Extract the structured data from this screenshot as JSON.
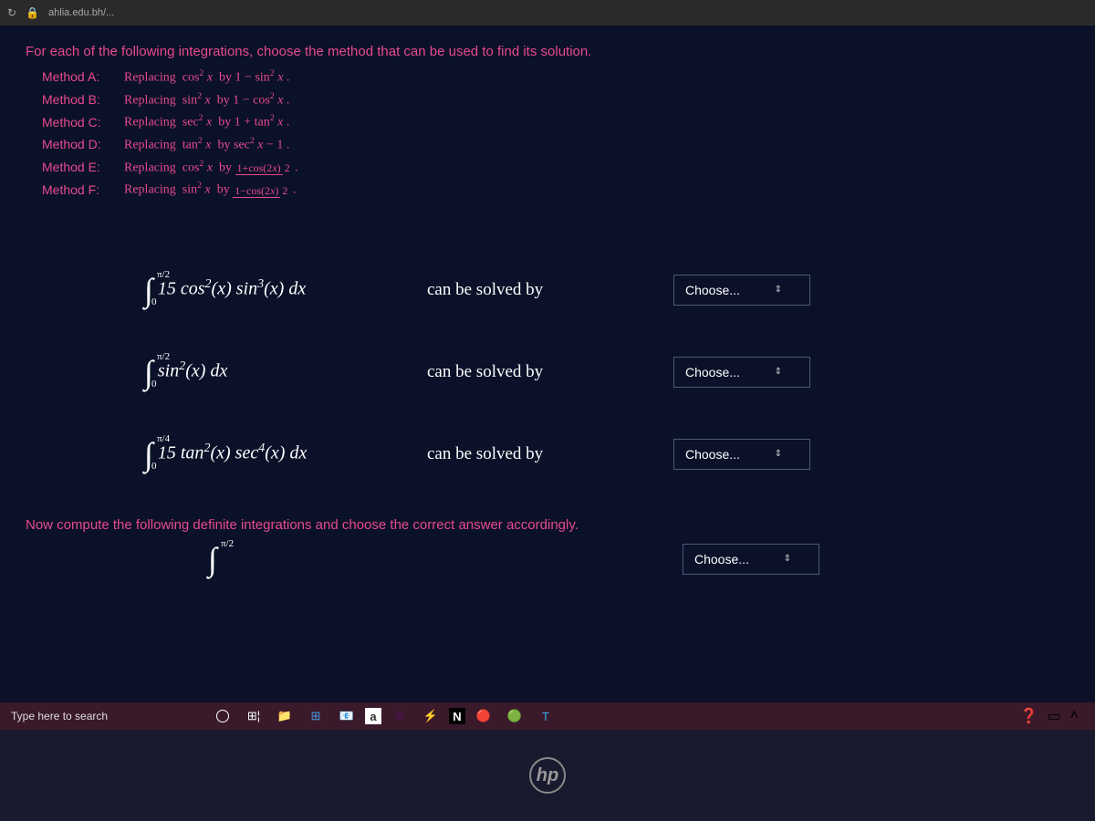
{
  "browser": {
    "url": "ahlia.edu.bh/..."
  },
  "instruction": "For each of the following integrations, choose the method that can be used to find its solution.",
  "methods": [
    {
      "label": "Method A:",
      "text": "Replacing  cos² x  by 1 − sin² x ."
    },
    {
      "label": "Method B:",
      "text": "Replacing  sin² x  by 1 − cos² x ."
    },
    {
      "label": "Method C:",
      "text": "Replacing  sec² x  by 1 + tan² x ."
    },
    {
      "label": "Method D:",
      "text": "Replacing  tan² x  by sec² x − 1 ."
    },
    {
      "label": "Method E:",
      "text_html": "Replacing  cos² x  by  (1+cos(2x)) / 2 ."
    },
    {
      "label": "Method F:",
      "text_html": "Replacing  sin² x  by  (1−cos(2x)) / 2 ."
    }
  ],
  "integrals": [
    {
      "upper": "π/2",
      "lower": "0",
      "expr": "15 cos²(x) sin³(x) dx",
      "solve": "can be solved by",
      "select": "Choose..."
    },
    {
      "upper": "π/2",
      "lower": "0",
      "expr": "sin²(x) dx",
      "solve": "can be solved by",
      "select": "Choose..."
    },
    {
      "upper": "π/4",
      "lower": "0",
      "expr": "15 tan²(x) sec⁴(x) dx",
      "solve": "can be solved by",
      "select": "Choose..."
    }
  ],
  "compute_text": "Now compute the following definite integrations and choose the correct answer accordingly.",
  "partial": {
    "upper": "π/2",
    "select": "Choose..."
  },
  "taskbar": {
    "search": "Type here to search"
  },
  "logo": "hp"
}
